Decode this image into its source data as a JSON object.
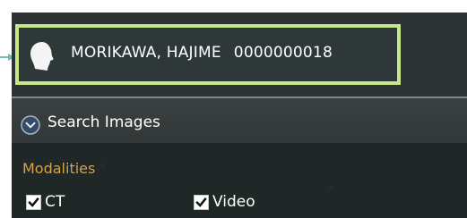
{
  "patient": {
    "name": "MORIKAWA, HAJIME",
    "id": "0000000018",
    "avatar_icon": "patient-head-icon"
  },
  "search": {
    "label": "Search Images",
    "expand_icon": "chevron-down-circle-icon"
  },
  "filters": {
    "modalities_label": "Modalities",
    "modalities": [
      {
        "label": "CT",
        "checked": true
      },
      {
        "label": "Video",
        "checked": true
      }
    ]
  },
  "colors": {
    "highlight_border": "#c7e88a",
    "section_label": "#d6a14b",
    "panel_background": "#2e3434",
    "text": "#ffffff"
  }
}
